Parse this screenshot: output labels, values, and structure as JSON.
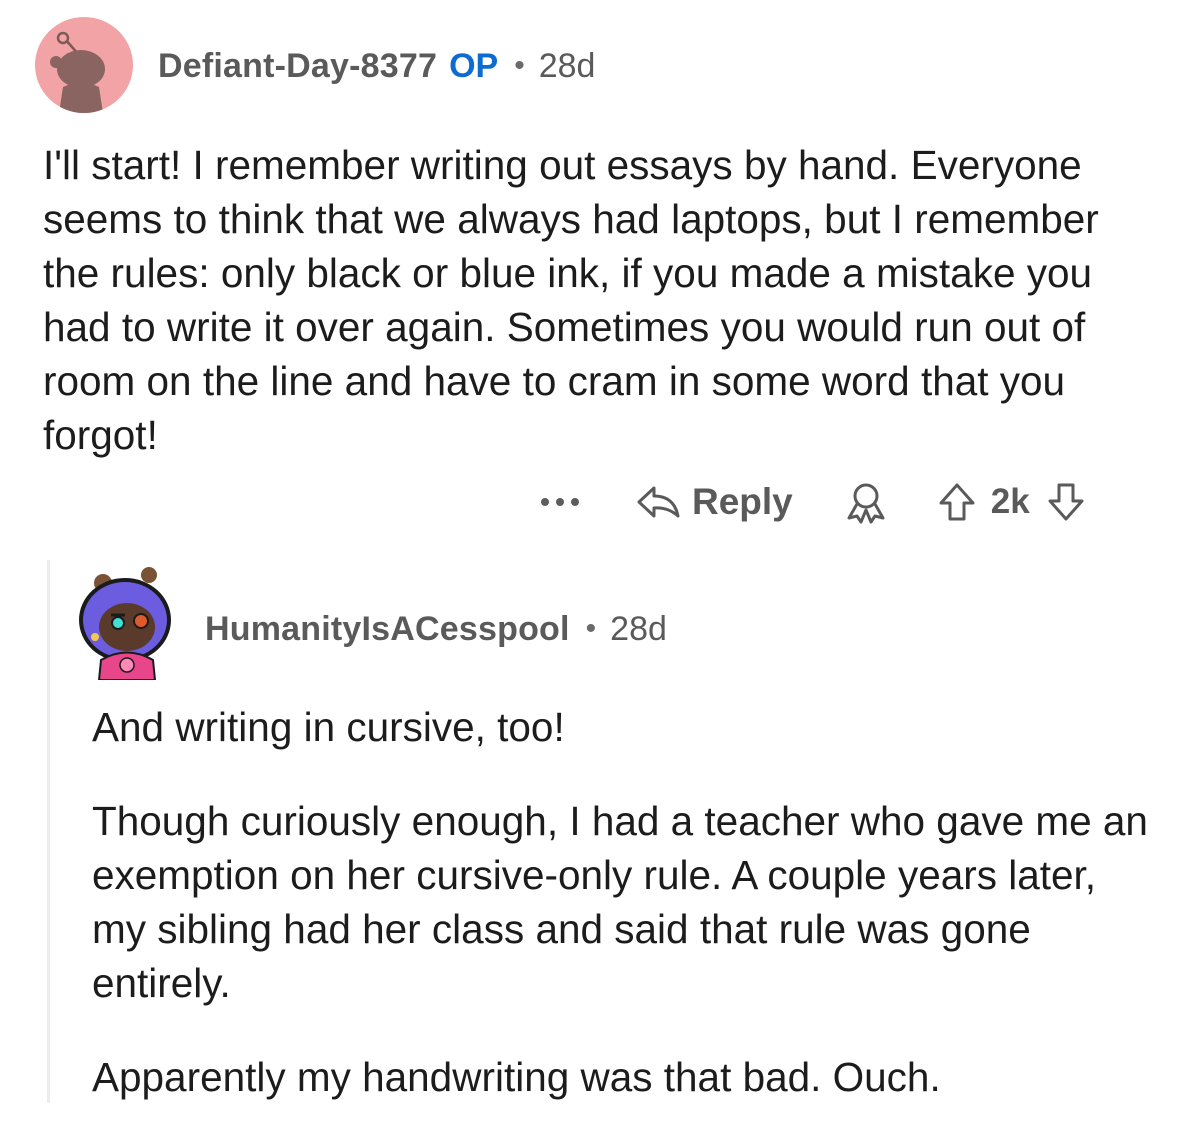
{
  "op_comment": {
    "username": "Defiant-Day-8377",
    "op_badge": "OP",
    "separator": "•",
    "age": "28d",
    "body": "I'll start! I remember writing out essays by hand. Everyone seems to think that we always had laptops, but I remember the rules: only black or blue ink, if you made a mistake you had to write it over again. Sometimes you would run out of room on the line and have to cram in some word that you forgot!",
    "avatar_icon": "snoo-avatar-icon",
    "avatar_bg_color": "#f2a3a6"
  },
  "actions": {
    "more_icon": "more-options-icon",
    "reply_icon": "reply-arrow-icon",
    "reply_label": "Reply",
    "award_icon": "award-icon",
    "upvote_icon": "upvote-arrow-icon",
    "score": "2k",
    "downvote_icon": "downvote-arrow-icon"
  },
  "reply_comment": {
    "username": "HumanityIsACesspool",
    "separator": "•",
    "age": "28d",
    "avatar_icon": "snoo-avatar-icon",
    "paragraphs": [
      "And writing in cursive, too!",
      "Though curiously enough, I had a teacher who gave me an exemption on her cursive-only rule. A couple years later, my sibling had her class and said that rule was gone entirely.",
      "Apparently my handwriting was that bad. Ouch."
    ]
  },
  "colors": {
    "op_badge": "#0e6bd1",
    "meta_text": "#5a5a5a",
    "body_text": "#1c1c1c",
    "thread_line": "#ececec"
  }
}
